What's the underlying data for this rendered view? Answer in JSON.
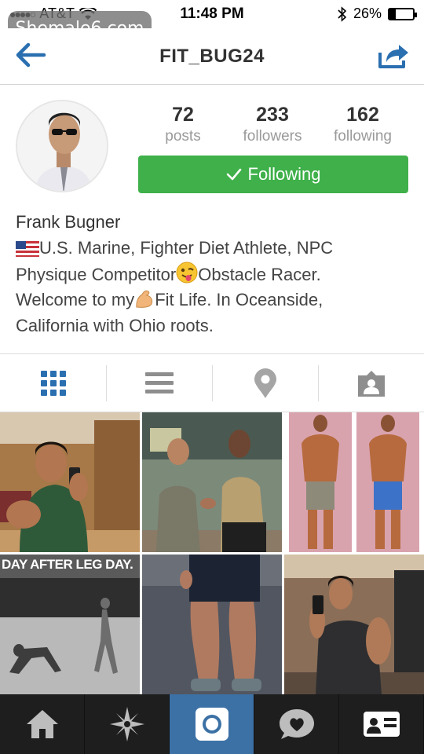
{
  "status_bar": {
    "carrier": "AT&T",
    "time": "11:48 PM",
    "battery": "26%",
    "battery_level": 0.26
  },
  "watermark": "Shemale6.com",
  "nav": {
    "title": "FIT_BUG24",
    "back_icon": "back-arrow-icon",
    "share_icon": "share-icon"
  },
  "profile": {
    "stats": [
      {
        "value": "72",
        "label": "posts"
      },
      {
        "value": "233",
        "label": "followers"
      },
      {
        "value": "162",
        "label": "following"
      }
    ],
    "follow_label": "Following",
    "name": "Frank Bugner",
    "bio": {
      "line1": "U.S. Marine, Fighter Diet Athlete, NPC",
      "line2a": "Physique Competitor",
      "line2b": "Obstacle Racer.",
      "line3a": "Welcome to my",
      "line3b": "Fit Life. In Oceanside,",
      "line4": "California with Ohio roots."
    }
  },
  "tabs": [
    {
      "icon": "grid-view-icon",
      "active": true
    },
    {
      "icon": "list-view-icon",
      "active": false
    },
    {
      "icon": "location-pin-icon",
      "active": false
    },
    {
      "icon": "tagged-person-icon",
      "active": false
    }
  ],
  "photos": {
    "leg_day_caption": "DAY AFTER LEG DAY."
  },
  "bottom_nav": [
    {
      "icon": "home-icon",
      "active": false
    },
    {
      "icon": "explore-star-icon",
      "active": false
    },
    {
      "icon": "camera-icon",
      "active": true
    },
    {
      "icon": "activity-bubble-icon",
      "active": false
    },
    {
      "icon": "profile-card-icon",
      "active": false
    }
  ],
  "colors": {
    "follow_green": "#3fb04a",
    "nav_blue": "#2a6fb0",
    "bottom_bar": "#1e1e1e",
    "bottom_active": "#3c71a6"
  }
}
